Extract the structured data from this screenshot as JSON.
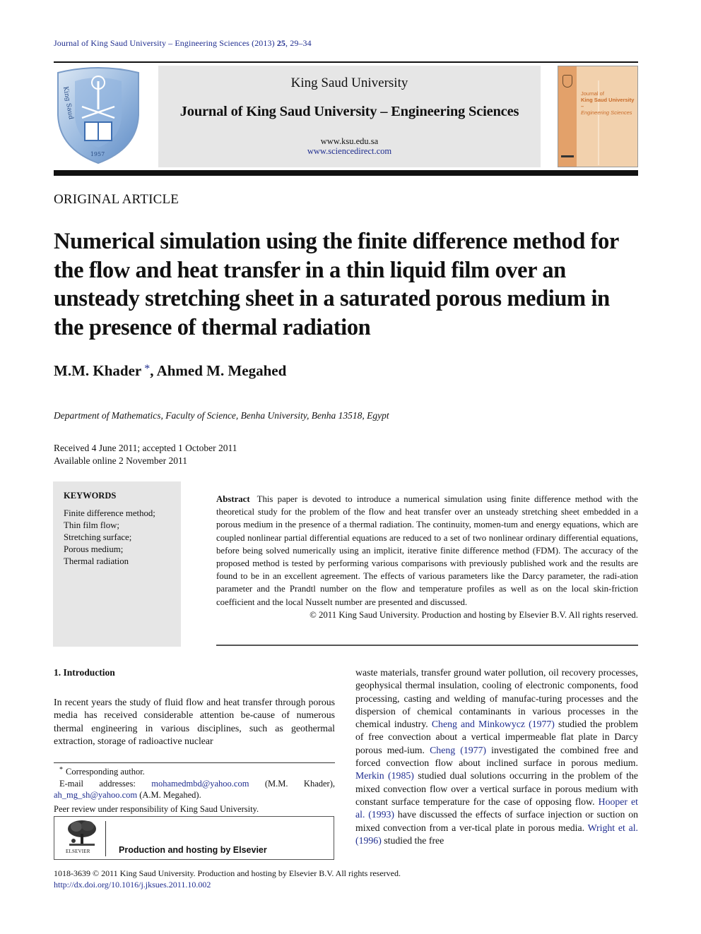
{
  "journal_ref": {
    "prefix": "Journal of King Saud University – Engineering Sciences (2013) ",
    "volume": "25",
    "pages": ", 29–34"
  },
  "header": {
    "university": "King Saud University",
    "journal_name": "Journal of King Saud University – Engineering Sciences",
    "url1": "www.ksu.edu.sa",
    "url2": "www.sciencedirect.com",
    "logo_icon": "ksu-crest-icon",
    "cover": {
      "line1": "Journal of",
      "line2": "King Saud University –",
      "line3": "Engineering Sciences"
    }
  },
  "article_type": "ORIGINAL ARTICLE",
  "title": "Numerical simulation using the finite difference method for the flow and heat transfer in a thin liquid film over an unsteady stretching sheet in a saturated porous medium in the presence of thermal radiation",
  "authors": {
    "first": "M.M. Khader",
    "star": "*",
    "rest": ", Ahmed M. Megahed"
  },
  "affiliation": "Department of Mathematics, Faculty of Science, Benha University, Benha 13518, Egypt",
  "dates": {
    "received": "Received 4 June 2011; accepted 1 October 2011",
    "online": "Available online 2 November 2011"
  },
  "keywords": {
    "heading": "KEYWORDS",
    "items": [
      "Finite difference method;",
      "Thin film flow;",
      "Stretching surface;",
      "Porous medium;",
      "Thermal radiation"
    ]
  },
  "abstract": {
    "label": "Abstract",
    "text": "This paper is devoted to introduce a numerical simulation using finite difference method with the theoretical study for the problem of the flow and heat transfer over an unsteady stretching sheet embedded in a porous medium in the presence of a thermal radiation. The continuity, momen-tum and energy equations, which are coupled nonlinear partial differential equations are reduced to a set of two nonlinear ordinary differential equations, before being solved numerically using an implicit, iterative finite difference method (FDM). The accuracy of the proposed method is tested by performing various comparisons with previously published work and the results are found to be in an excellent agreement. The effects of various parameters like the Darcy parameter, the radi-ation parameter and the Prandtl number on the flow and temperature profiles as well as on the local skin-friction coefficient and the local Nusselt number are presented and discussed.",
    "copyright": "© 2011 King Saud University. Production and hosting by Elsevier B.V. All rights reserved."
  },
  "intro": {
    "heading": "1. Introduction",
    "left_text": "In recent years the study of fluid flow and heat transfer through porous media has received considerable attention be-cause of numerous thermal engineering in various disciplines, such as geothermal extraction, storage of radioactive nuclear",
    "right": {
      "t1": "waste materials, transfer ground water pollution, oil recovery processes, geophysical thermal insulation, cooling of electronic components, food processing, casting and welding of manufac-turing processes and the dispersion of chemical contaminants in various processes in the chemical industry. ",
      "ref1": "Cheng and Minkowycz (1977)",
      "t2": " studied the problem of free convection about a vertical impermeable flat plate in Darcy porous med-ium. ",
      "ref2": "Cheng (1977)",
      "t3": " investigated the combined free and forced convection flow about inclined surface in porous medium. ",
      "ref3": "Merkin (1985)",
      "t4": " studied dual solutions occurring in the problem of the mixed convection flow over a vertical surface in porous medium with constant surface temperature for the case of opposing flow. ",
      "ref4": "Hooper et al. (1993)",
      "t5": " have discussed the effects of surface injection or suction on mixed convection from a ver-tical plate in porous media. ",
      "ref5": "Wright et al. (1996)",
      "t6": " studied the free"
    }
  },
  "footnotes": {
    "star": "*",
    "corresponding": "Corresponding author.",
    "email_label": "E-mail addresses: ",
    "email1": "mohamedmbd@yahoo.com",
    "email1_owner": " (M.M. Khader),",
    "email2": "ah_mg_sh@yahoo.com",
    "email2_owner": " (A.M. Megahed).",
    "peer_review": "Peer review under responsibility of King Saud University."
  },
  "elsevier": {
    "logo_text": "ELSEVIER",
    "production": "Production and hosting by Elsevier"
  },
  "footer": {
    "issn_line": "1018-3639 © 2011 King Saud University. Production and hosting by Elsevier B.V. All rights reserved.",
    "doi": "http://dx.doi.org/10.1016/j.jksues.2011.10.002"
  }
}
